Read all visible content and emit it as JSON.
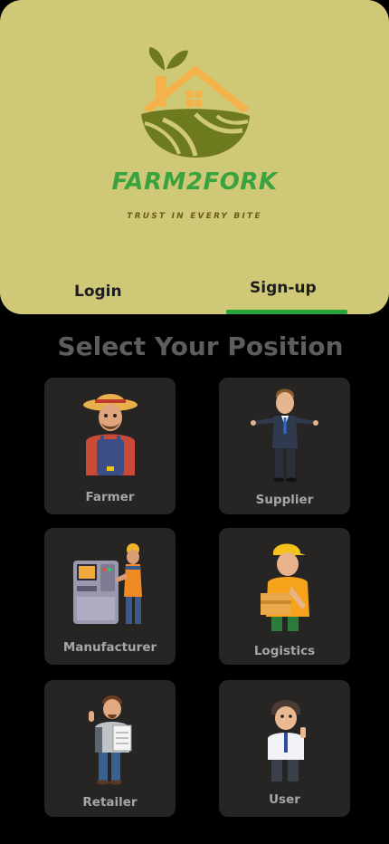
{
  "brand": {
    "name": "FARM2FORK",
    "tagline": "TRUST IN EVERY BITE"
  },
  "tabs": {
    "login": "Login",
    "signup": "Sign-up",
    "active": "signup"
  },
  "main": {
    "title": "Select Your Position"
  },
  "positions": [
    {
      "label": "Farmer",
      "icon": "farmer-avatar"
    },
    {
      "label": "Supplier",
      "icon": "supplier-avatar"
    },
    {
      "label": "Manufacturer",
      "icon": "manufacturer-avatar"
    },
    {
      "label": "Logistics",
      "icon": "logistics-avatar"
    },
    {
      "label": "Retailer",
      "icon": "retailer-avatar"
    },
    {
      "label": "User",
      "icon": "user-avatar"
    }
  ],
  "colors": {
    "header_bg": "#cfc977",
    "brand_green": "#3aa33f",
    "tab_indicator": "#27a43a",
    "card_bg": "#272524",
    "page_bg": "#000000"
  }
}
